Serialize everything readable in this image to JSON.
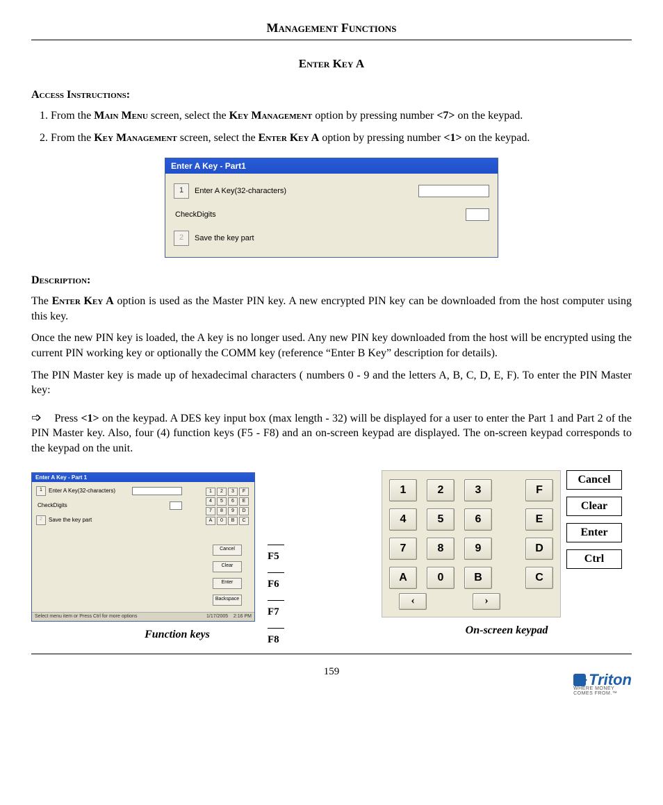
{
  "header": {
    "title": "Management Functions",
    "subtitle": "Enter Key A"
  },
  "access": {
    "label": "Access Instructions:",
    "items": [
      {
        "pre": "From the ",
        "s1": "Main Menu",
        "mid1": " screen, select the ",
        "s2": "Key Management",
        "mid2": " option by pressing number ",
        "key": "<7>",
        "post": " on the keypad."
      },
      {
        "pre": "From the ",
        "s1": "Key Management",
        "mid1": " screen, select the ",
        "s2": "Enter Key A",
        "mid2": " option by pressing number ",
        "key": "<1>",
        "post": " on the keypad."
      }
    ]
  },
  "dialog1": {
    "title": "Enter A Key - Part1",
    "row1_num": "1",
    "row1_label": "Enter A Key(32-characters)",
    "check_label": "CheckDigits",
    "row2_num": "2",
    "row2_label": "Save the key part"
  },
  "description": {
    "label": "Description:",
    "p1a": "The ",
    "p1b": "Enter Key A",
    "p1c": " option is used as the Master PIN key.  A new encrypted PIN key can be downloaded from the host computer using this key.",
    "p2": "Once the new PIN key is loaded, the A key is no longer used. Any new PIN key downloaded from the host will be encrypted using the current PIN working key or optionally the COMM key (reference “Enter B Key” description for details).",
    "p3": "The PIN Master key is made up of hexadecimal characters ( numbers 0 - 9 and the letters A, B, C, D, E, F). To enter the PIN Master key:",
    "arrow": "➩",
    "p4a": "Press ",
    "p4b": "<1>",
    "p4c": " on the keypad. A DES key input box (max length - 32) will be displayed for a user to enter the Part 1 and Part 2 of the PIN Master key.  Also, four (4) function keys (F5 - F8) and an on-screen keypad are displayed. The on-screen keypad corresponds to the keypad on the unit."
  },
  "mini": {
    "title": "Enter A Key - Part 1",
    "row1_num": "1",
    "row1_label": "Enter A Key(32-characters)",
    "check_label": "CheckDigits",
    "row2_num": "2",
    "row2_label": "Save the key part",
    "grid": [
      "1",
      "2",
      "3",
      "F",
      "4",
      "5",
      "6",
      "E",
      "7",
      "8",
      "9",
      "D",
      "A",
      "0",
      "B",
      "C"
    ],
    "fn": [
      "Cancel",
      "Clear",
      "Enter",
      "Backspace"
    ],
    "status_left": "Select menu item or Press Ctrl for more options",
    "status_date": "1/17/2005",
    "status_time": "2:16 PM"
  },
  "fn_labels": [
    "F5",
    "F6",
    "F7",
    "F8"
  ],
  "keypad": {
    "rows": [
      [
        "1",
        "2",
        "3",
        "F"
      ],
      [
        "4",
        "5",
        "6",
        "E"
      ],
      [
        "7",
        "8",
        "9",
        "D"
      ],
      [
        "A",
        "0",
        "B",
        "C"
      ]
    ],
    "arrows": [
      "‹",
      "›"
    ],
    "side": [
      "Cancel",
      "Clear",
      "Enter",
      "Ctrl"
    ]
  },
  "captions": {
    "left": "Function keys",
    "right": "On-screen keypad"
  },
  "footer": {
    "page": "159",
    "brand": "Triton",
    "tagline": "WHERE MONEY COMES FROM.™"
  }
}
